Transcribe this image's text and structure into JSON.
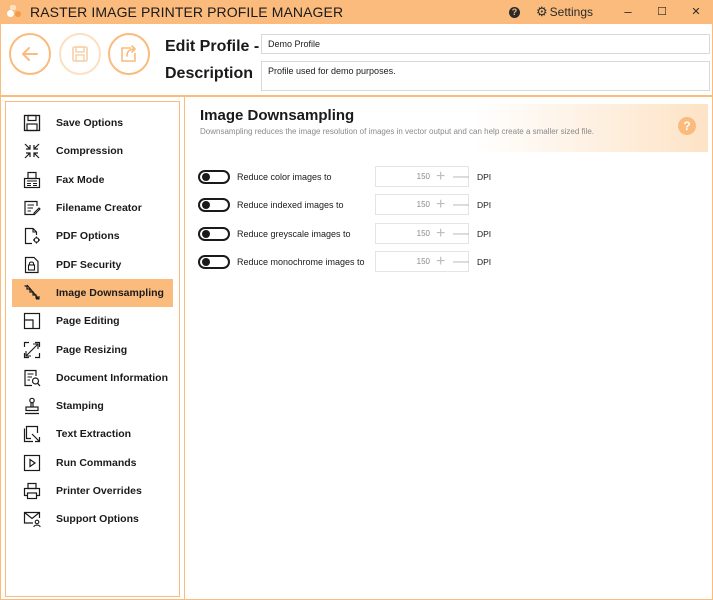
{
  "app": {
    "title": "RASTER IMAGE PRINTER PROFILE MANAGER",
    "settings_label": "Settings",
    "help_glyph": "?",
    "window_controls": {
      "minimize": "–",
      "maximize": "☐",
      "close": "✕"
    }
  },
  "header": {
    "edit_profile_label": "Edit Profile -",
    "description_label": "Description",
    "profile_name": "Demo Profile",
    "profile_description": "Profile used for demo purposes.",
    "buttons": {
      "back": "back-arrow-icon",
      "save": "save-icon",
      "export": "export-icon"
    }
  },
  "sidebar": {
    "items": [
      {
        "label": "Save Options",
        "icon": "save-icon",
        "active": false
      },
      {
        "label": "Compression",
        "icon": "compress-icon",
        "active": false
      },
      {
        "label": "Fax Mode",
        "icon": "fax-icon",
        "active": false
      },
      {
        "label": "Filename Creator",
        "icon": "filename-edit-icon",
        "active": false
      },
      {
        "label": "PDF Options",
        "icon": "pdf-settings-icon",
        "active": false
      },
      {
        "label": "PDF Security",
        "icon": "pdf-lock-icon",
        "active": false
      },
      {
        "label": "Image Downsampling",
        "icon": "downsample-icon",
        "active": true
      },
      {
        "label": "Page Editing",
        "icon": "page-edit-icon",
        "active": false
      },
      {
        "label": "Page Resizing",
        "icon": "resize-icon",
        "active": false
      },
      {
        "label": "Document Information",
        "icon": "document-search-icon",
        "active": false
      },
      {
        "label": "Stamping",
        "icon": "stamp-icon",
        "active": false
      },
      {
        "label": "Text Extraction",
        "icon": "text-extraction-icon",
        "active": false
      },
      {
        "label": "Run Commands",
        "icon": "run-icon",
        "active": false
      },
      {
        "label": "Printer Overrides",
        "icon": "printer-icon",
        "active": false
      },
      {
        "label": "Support Options",
        "icon": "support-mail-icon",
        "active": false
      }
    ]
  },
  "content": {
    "title": "Image Downsampling",
    "description": "Downsampling reduces the image resolution of images in vector output and can help create a smaller sized file.",
    "help_glyph": "?",
    "options": [
      {
        "label": "Reduce color images to",
        "value": "150",
        "unit": "DPI",
        "enabled": false
      },
      {
        "label": "Reduce indexed images to",
        "value": "150",
        "unit": "DPI",
        "enabled": false
      },
      {
        "label": "Reduce greyscale images to",
        "value": "150",
        "unit": "DPI",
        "enabled": false
      },
      {
        "label": "Reduce monochrome images to",
        "value": "150",
        "unit": "DPI",
        "enabled": false
      }
    ],
    "plus_glyph": "+",
    "minus_glyph": "—"
  },
  "colors": {
    "accent": "#fbbb7c",
    "accent_light": "#fde3c6",
    "text": "#1a1a1a",
    "muted": "#8a8a8a"
  }
}
